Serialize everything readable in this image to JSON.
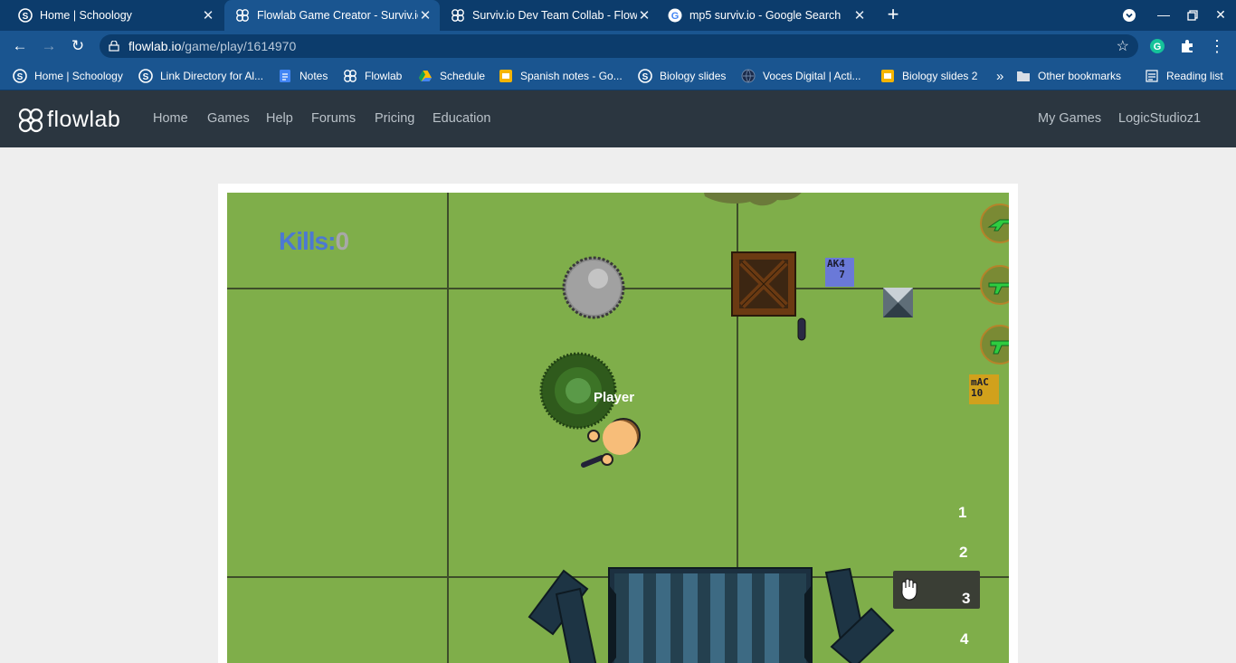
{
  "browser": {
    "tabs": [
      {
        "title": "Home | Schoology",
        "active": false,
        "icon": "schoology-icon"
      },
      {
        "title": "Flowlab Game Creator - Surviv.io",
        "active": true,
        "icon": "flowlab-icon"
      },
      {
        "title": "Surviv.io Dev Team Collab - Flow",
        "active": false,
        "icon": "flowlab-icon"
      },
      {
        "title": "mp5 surviv.io - Google Search",
        "active": false,
        "icon": "google-icon"
      }
    ],
    "new_tab_label": "+",
    "url_host": "flowlab.io",
    "url_path": "/game/play/1614970",
    "bookmarks": [
      {
        "label": "Home | Schoology",
        "icon": "schoology-icon"
      },
      {
        "label": "Link Directory for Al...",
        "icon": "schoology-icon"
      },
      {
        "label": "Notes",
        "icon": "docs-icon"
      },
      {
        "label": "Flowlab",
        "icon": "flowlab-icon"
      },
      {
        "label": "Schedule",
        "icon": "drive-icon"
      },
      {
        "label": "Spanish notes - Go...",
        "icon": "slides-icon"
      },
      {
        "label": "Biology slides",
        "icon": "schoology-icon"
      },
      {
        "label": "Voces Digital | Acti...",
        "icon": "globe-icon"
      },
      {
        "label": "Biology slides 2",
        "icon": "slides-icon"
      }
    ],
    "overflow_label": "»",
    "other_bookmarks": "Other bookmarks",
    "reading_list": "Reading list"
  },
  "site": {
    "logo_text": "flowlab",
    "nav": [
      "Home",
      "Games",
      "Help",
      "Forums",
      "Pricing",
      "Education"
    ],
    "right_nav": [
      "My Games",
      "LogicStudioz1"
    ]
  },
  "game": {
    "kills_label": "Kills:",
    "kills_value": "0",
    "player_label": "Player",
    "slots": [
      "1",
      "2",
      "3",
      "4"
    ],
    "tag_blue_text": "AK4\n  7",
    "tag_gold_text": "mAC\n10"
  },
  "colors": {
    "tab_bar": "#0c3c6c",
    "toolbar": "#1a5590",
    "site_nav": "#2b3640",
    "grass": "#7fae4a"
  }
}
